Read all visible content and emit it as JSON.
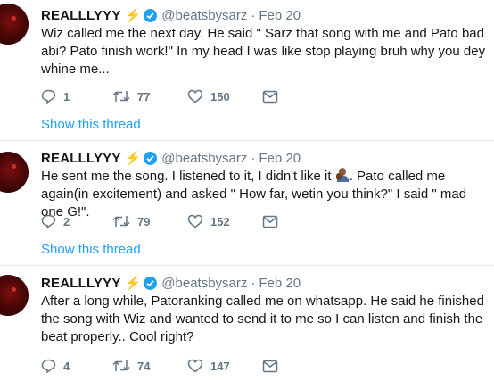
{
  "colors": {
    "accent": "#1da1f2",
    "muted": "#657786",
    "text": "#14171a",
    "bolt": "#f5a623"
  },
  "tweets": [
    {
      "name": "REALLLYYY",
      "bolt": "⚡",
      "handle": "@beatsbysarz",
      "sep": "·",
      "date": "Feb 20",
      "text_before": "Wiz called me the next day. He said \" Sarz that song with me and Pato bad abi? Pato finish work!\" In my head I was like stop playing bruh why you dey whine me...",
      "text_after": "",
      "replies": "1",
      "retweets": "77",
      "likes": "150",
      "show_thread": "Show this thread"
    },
    {
      "name": "REALLLYYY",
      "bolt": "⚡",
      "handle": "@beatsbysarz",
      "sep": "·",
      "date": "Feb 20",
      "text_before": "He sent me the song. I listened to it, I didn't like it ",
      "emoji": "person-facepalming",
      "text_after": ". Pato called me again(in excitement) and asked \" How far, wetin you think?\" I said \" mad one G!\".",
      "replies": "2",
      "retweets": "79",
      "likes": "152",
      "show_thread": "Show this thread"
    },
    {
      "name": "REALLLYYY",
      "bolt": "⚡",
      "handle": "@beatsbysarz",
      "sep": "·",
      "date": "Feb 20",
      "text_before": "After a long while, Patoranking called me on whatsapp. He said he finished the song with Wiz and wanted to send it to me so I can listen and finish the beat properly.. Cool right?",
      "text_after": "",
      "replies": "4",
      "retweets": "74",
      "likes": "147"
    }
  ],
  "icons": {
    "reply": "reply-icon",
    "retweet": "retweet-icon",
    "like": "heart-icon",
    "dm": "message-icon",
    "verified": "verified-badge-icon",
    "bolt": "lightning-bolt-icon"
  }
}
